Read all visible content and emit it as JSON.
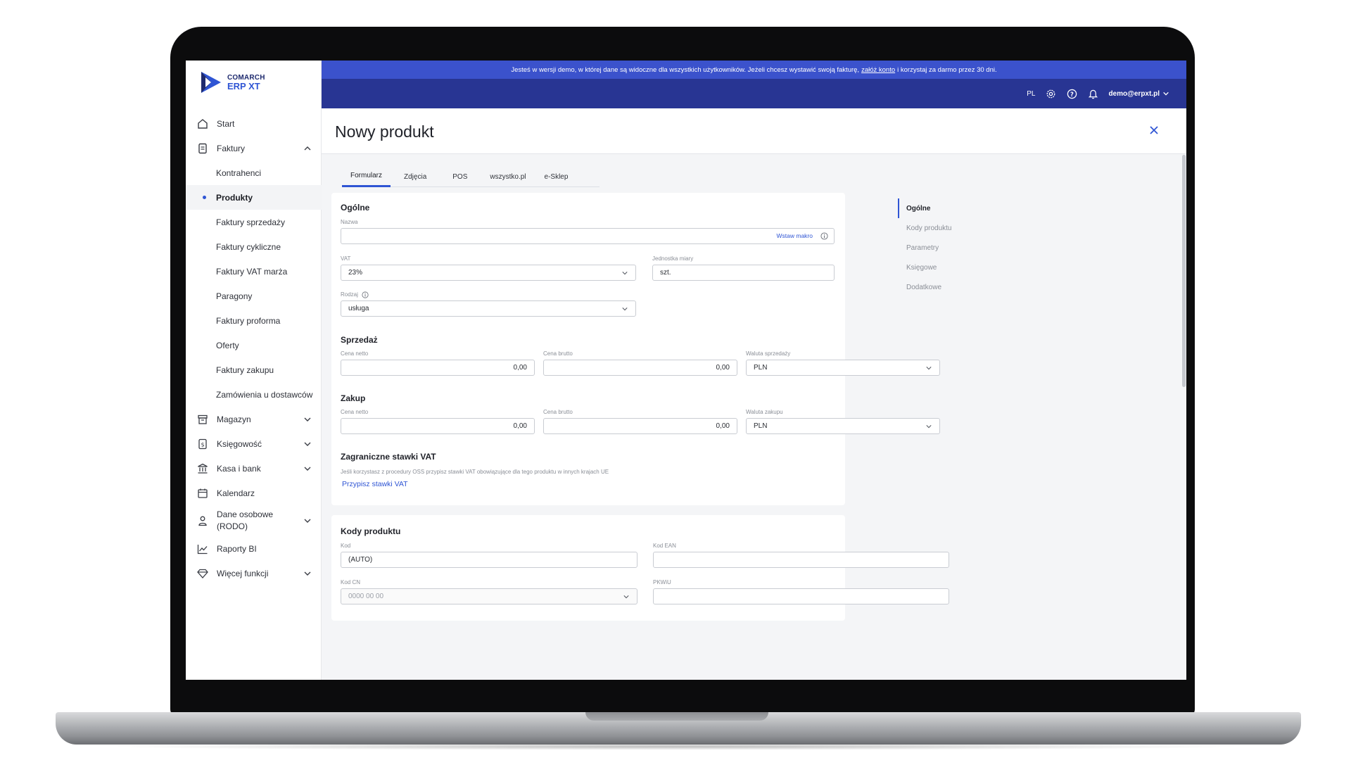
{
  "banner": {
    "text_before": "Jesteś w wersji demo, w której dane są widoczne dla wszystkich użytkowników. Jeżeli chcesz wystawić swoją fakturę,",
    "link": "załóż konto",
    "text_after": "i korzystaj za darmo przez 30 dni."
  },
  "topbar": {
    "lang": "PL",
    "user": "demo@erpxt.pl"
  },
  "logo": {
    "brand": "COMARCH",
    "product": "ERP XT"
  },
  "sidebar": {
    "items": [
      {
        "label": "Start"
      },
      {
        "label": "Faktury"
      },
      {
        "label": "Kontrahenci"
      },
      {
        "label": "Produkty"
      },
      {
        "label": "Faktury sprzedaży"
      },
      {
        "label": "Faktury cykliczne"
      },
      {
        "label": "Faktury VAT marża"
      },
      {
        "label": "Paragony"
      },
      {
        "label": "Faktury proforma"
      },
      {
        "label": "Oferty"
      },
      {
        "label": "Faktury zakupu"
      },
      {
        "label": "Zamówienia u dostawców"
      },
      {
        "label": "Magazyn"
      },
      {
        "label": "Księgowość"
      },
      {
        "label": "Kasa i bank"
      },
      {
        "label": "Kalendarz"
      },
      {
        "label": "Dane osobowe",
        "label2": "(RODO)"
      },
      {
        "label": "Raporty BI"
      },
      {
        "label": "Więcej funkcji"
      }
    ]
  },
  "page": {
    "title": "Nowy produkt"
  },
  "tabs": [
    "Formularz",
    "Zdjęcia",
    "POS",
    "wszystko.pl",
    "e-Sklep"
  ],
  "form": {
    "general": {
      "title": "Ogólne",
      "name_label": "Nazwa",
      "name_value": "",
      "macro": "Wstaw makro",
      "vat_label": "VAT",
      "vat_value": "23%",
      "unit_label": "Jednostka miary",
      "unit_value": "szt.",
      "kind_label": "Rodzaj",
      "kind_value": "usługa"
    },
    "sale": {
      "title": "Sprzedaż",
      "net_label": "Cena netto",
      "net_value": "0,00",
      "gross_label": "Cena brutto",
      "gross_value": "0,00",
      "currency_label": "Waluta sprzedaży",
      "currency_value": "PLN"
    },
    "purchase": {
      "title": "Zakup",
      "net_label": "Cena netto",
      "net_value": "0,00",
      "gross_label": "Cena brutto",
      "gross_value": "0,00",
      "currency_label": "Waluta zakupu",
      "currency_value": "PLN"
    },
    "foreign_vat": {
      "title": "Zagraniczne stawki VAT",
      "help": "Jeśli korzystasz z procedury OSS przypisz stawki VAT obowiązujące dla tego produktu w innych krajach UE",
      "link": "Przypisz stawki VAT"
    },
    "codes": {
      "title": "Kody produktu",
      "code_label": "Kod",
      "code_value": "(AUTO)",
      "ean_label": "Kod EAN",
      "ean_value": "",
      "cn_label": "Kod CN",
      "cn_placeholder": "0000 00 00",
      "pkwiu_label": "PKWiU",
      "pkwiu_value": ""
    }
  },
  "anchors": [
    "Ogólne",
    "Kody produktu",
    "Parametry",
    "Księgowe",
    "Dodatkowe"
  ],
  "colors": {
    "accent": "#2f55d4",
    "topbar": "#283593",
    "banner": "#3b52cc"
  }
}
